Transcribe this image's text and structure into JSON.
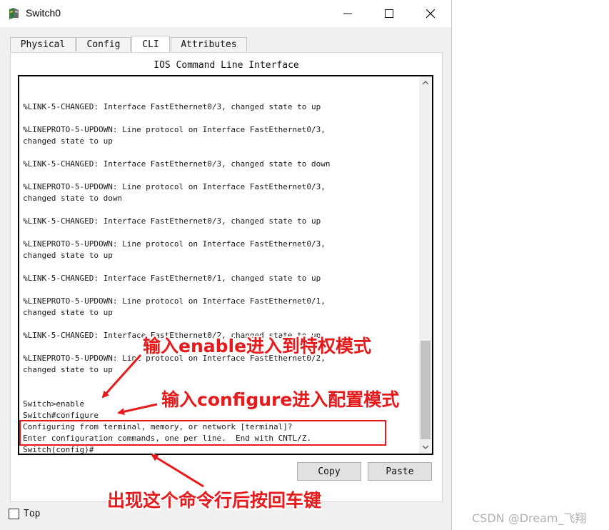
{
  "window": {
    "title": "Switch0",
    "icon": "switch-device-icon",
    "controls": {
      "minimize": "minimize-icon",
      "maximize": "maximize-icon",
      "close": "close-icon"
    }
  },
  "tabs": [
    {
      "label": "Physical",
      "active": false
    },
    {
      "label": "Config",
      "active": false
    },
    {
      "label": "CLI",
      "active": true
    },
    {
      "label": "Attributes",
      "active": false
    }
  ],
  "panel": {
    "title": "IOS Command Line Interface"
  },
  "terminal": {
    "lines": [
      "",
      "",
      "",
      "%LINK-5-CHANGED: Interface FastEthernet0/3, changed state to up",
      "",
      "%LINEPROTO-5-UPDOWN: Line protocol on Interface FastEthernet0/3,",
      "changed state to up",
      "",
      "%LINK-5-CHANGED: Interface FastEthernet0/3, changed state to down",
      "",
      "%LINEPROTO-5-UPDOWN: Line protocol on Interface FastEthernet0/3,",
      "changed state to down",
      "",
      "%LINK-5-CHANGED: Interface FastEthernet0/3, changed state to up",
      "",
      "%LINEPROTO-5-UPDOWN: Line protocol on Interface FastEthernet0/3,",
      "changed state to up",
      "",
      "%LINK-5-CHANGED: Interface FastEthernet0/1, changed state to up",
      "",
      "%LINEPROTO-5-UPDOWN: Line protocol on Interface FastEthernet0/1,",
      "changed state to up",
      "",
      "%LINK-5-CHANGED: Interface FastEthernet0/2, changed state to up",
      "",
      "%LINEPROTO-5-UPDOWN: Line protocol on Interface FastEthernet0/2,",
      "changed state to up",
      "",
      "",
      "Switch>enable",
      "Switch#configure",
      "Configuring from terminal, memory, or network [terminal]?",
      "Enter configuration commands, one per line.  End with CNTL/Z.",
      "Switch(config)#"
    ]
  },
  "buttons": {
    "copy": "Copy",
    "paste": "Paste"
  },
  "top_checkbox": {
    "label": "Top",
    "checked": false
  },
  "annotations": {
    "enable_note": "输入enable进入到特权模式",
    "configure_note": "输入configure进入配置模式",
    "enter_note": "出现这个命令行后按回车键",
    "color": "#e8191a"
  },
  "watermark": "CSDN @Dream_飞翔"
}
